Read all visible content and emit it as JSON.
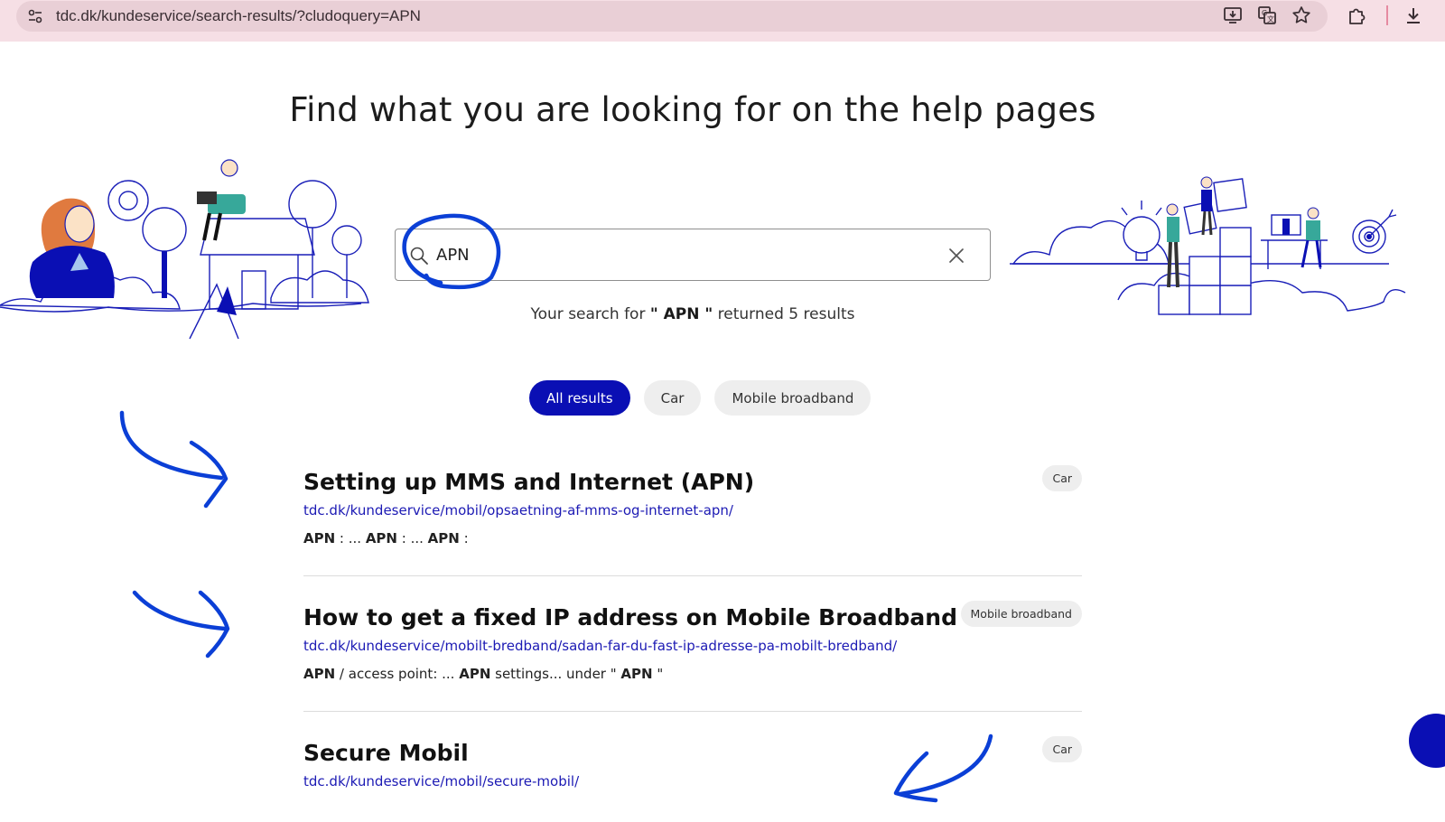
{
  "browser": {
    "url": "tdc.dk/kundeservice/search-results/?cludoquery=APN"
  },
  "page": {
    "title": "Find what you are looking for on the help pages"
  },
  "search": {
    "value": "APN",
    "summary_prefix": "Your search for",
    "summary_query": "\" APN \"",
    "summary_suffix": "returned 5 results"
  },
  "filters": [
    {
      "label": "All results",
      "active": true
    },
    {
      "label": "Car",
      "active": false
    },
    {
      "label": "Mobile broadband",
      "active": false
    }
  ],
  "results": [
    {
      "title": "Setting up MMS and Internet (APN)",
      "url": "tdc.dk/kundeservice/mobil/opsaetning-af-mms-og-internet-apn/",
      "snippet": [
        {
          "text": "APN",
          "bold": true
        },
        {
          "text": " : ... ",
          "bold": false
        },
        {
          "text": "APN",
          "bold": true
        },
        {
          "text": " : ... ",
          "bold": false
        },
        {
          "text": "APN",
          "bold": true
        },
        {
          "text": " :",
          "bold": false
        }
      ],
      "tag": "Car"
    },
    {
      "title": "How to get a fixed IP address on Mobile Broadband",
      "url": "tdc.dk/kundeservice/mobilt-bredband/sadan-far-du-fast-ip-adresse-pa-mobilt-bredband/",
      "snippet": [
        {
          "text": "APN",
          "bold": true
        },
        {
          "text": " / access point: ... ",
          "bold": false
        },
        {
          "text": "APN",
          "bold": true
        },
        {
          "text": " settings... under \" ",
          "bold": false
        },
        {
          "text": "APN",
          "bold": true
        },
        {
          "text": " \"",
          "bold": false
        }
      ],
      "tag": "Mobile broadband"
    },
    {
      "title": "Secure Mobil",
      "url": "tdc.dk/kundeservice/mobil/secure-mobil/",
      "snippet": [],
      "tag": "Car"
    }
  ],
  "colors": {
    "accent": "#0a0fb4",
    "link": "#1c1ab4",
    "annotation": "#0b3fd6"
  }
}
